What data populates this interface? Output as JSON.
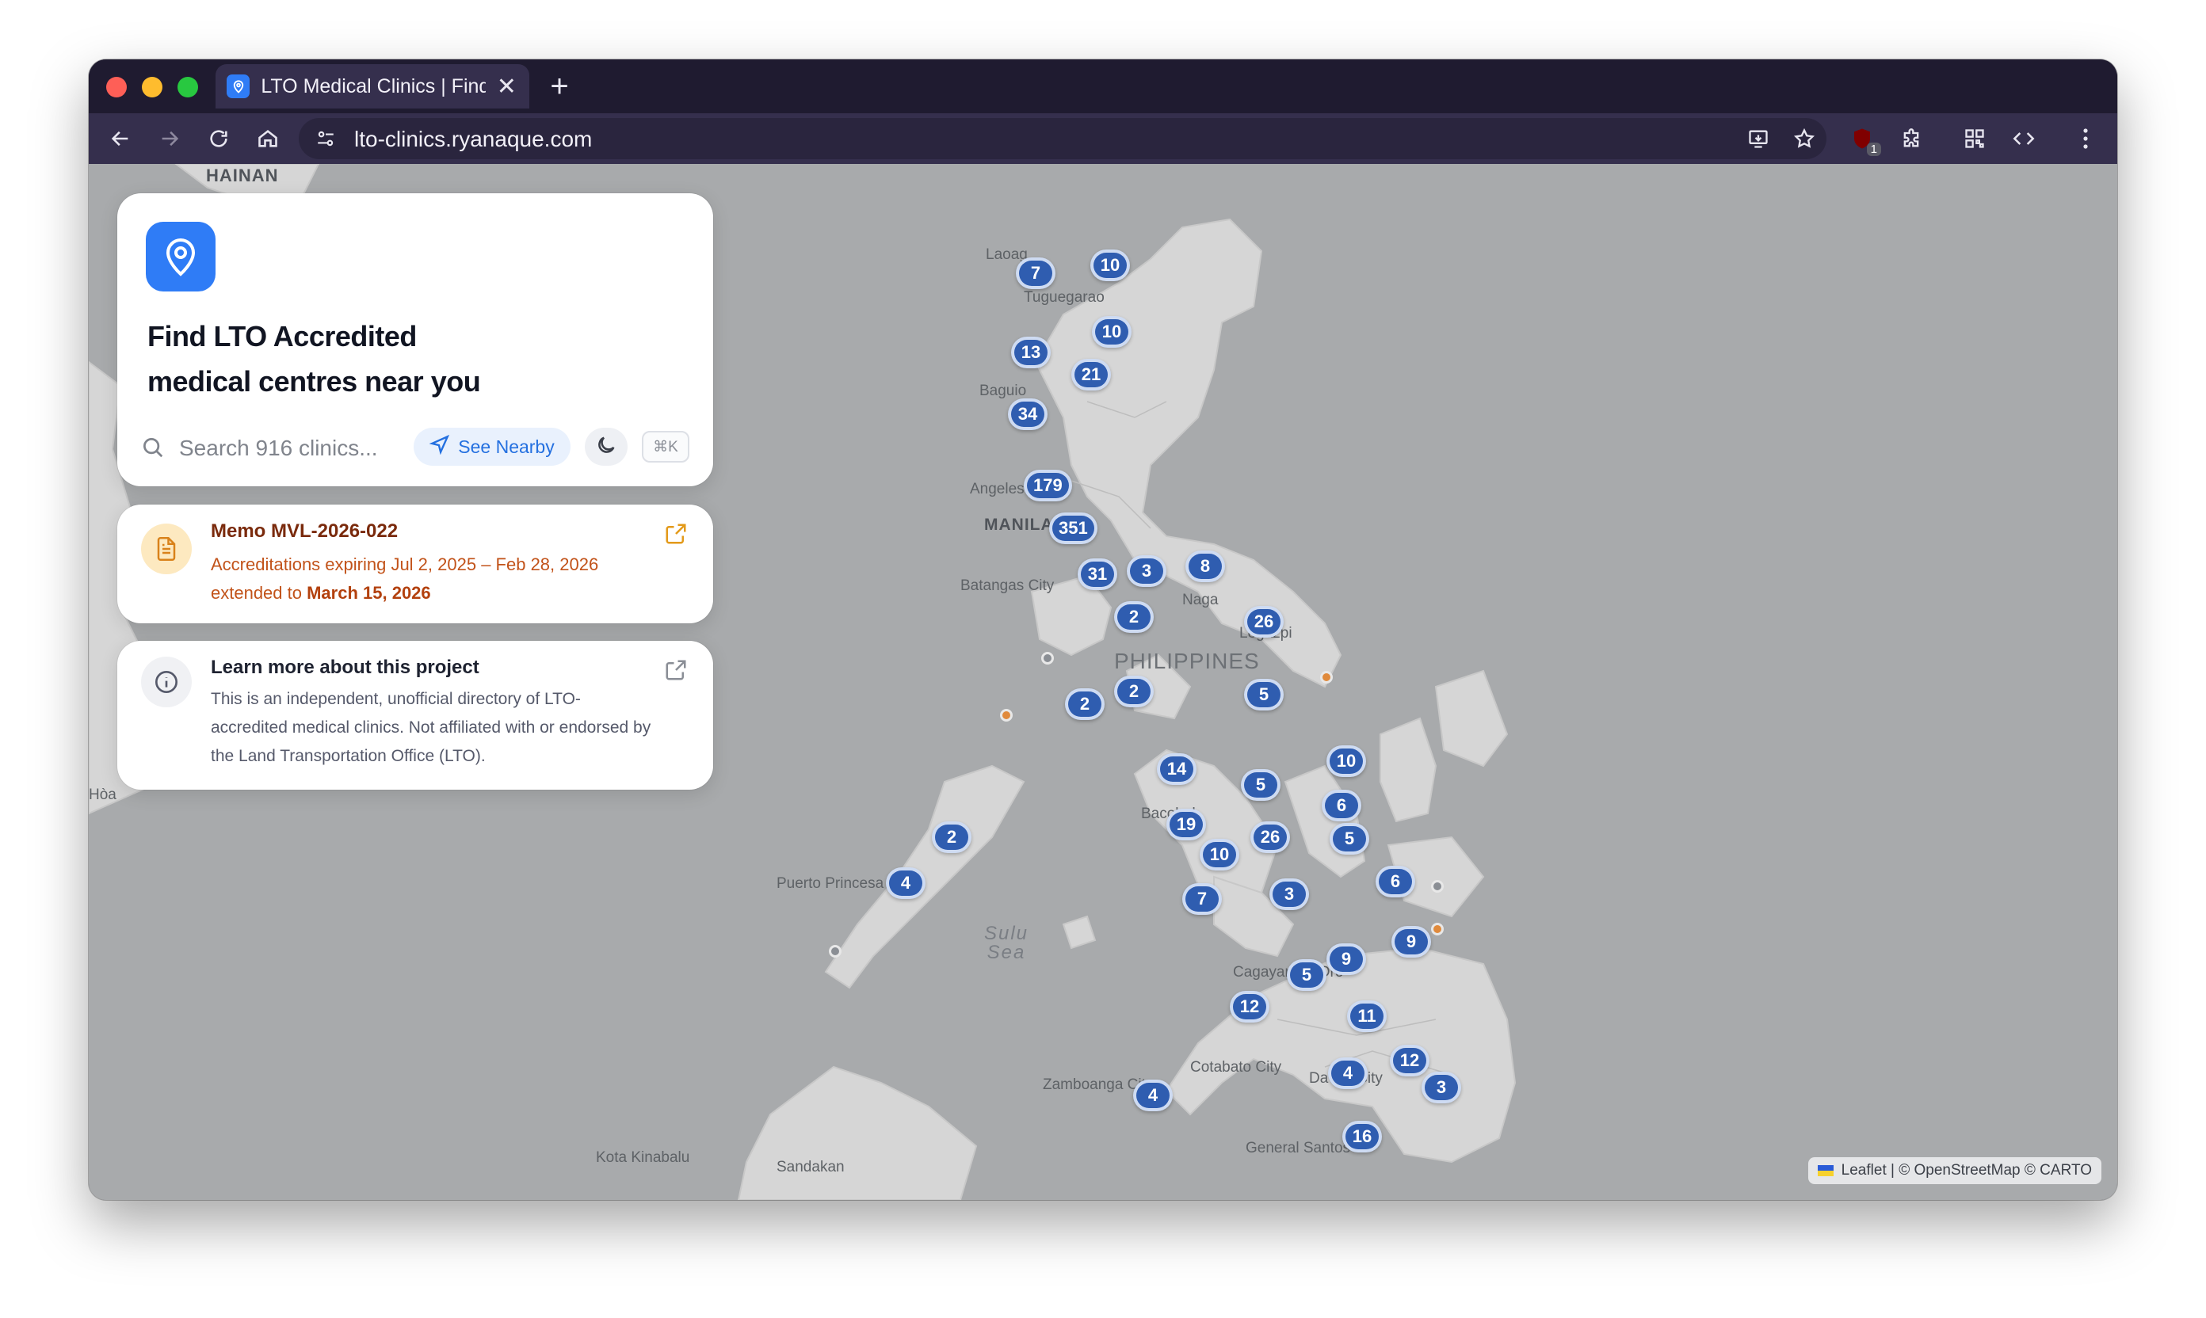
{
  "browser": {
    "tab_title": "LTO Medical Clinics | Find LTO Accredited",
    "url": "lto-clinics.ryanaque.com",
    "extension_badge": "1"
  },
  "hero": {
    "title_line1": "Find LTO Accredited",
    "title_line2": "medical centres near you",
    "search_placeholder": "Search 916 clinics...",
    "nearby_label": "See Nearby",
    "shortcut": "⌘K"
  },
  "memo": {
    "title": "Memo MVL-2026-022",
    "line1": "Accreditations expiring Jul 2, 2025 – Feb 28, 2026",
    "line2_prefix": "extended to",
    "line2_date": "March 15, 2026"
  },
  "info": {
    "title": "Learn more about this project",
    "text": "This is an independent, unofficial directory of LTO-accredited medical clinics. Not affiliated with or endorsed by the Land Transportation Office (LTO)."
  },
  "map": {
    "country": "PHILIPPINES",
    "sea": "Sulu Sea",
    "places": [
      "HAINAN",
      "Laoag",
      "Tuguegarao",
      "Baguio",
      "Angeles",
      "MANILA",
      "Batangas City",
      "Naga",
      "Legazpi",
      "Puerto Princesa",
      "Bacolod",
      "Cagayan de Oro",
      "Cotabato City",
      "Davao City",
      "Zamboanga City",
      "General Santos",
      "Kota Kinabalu",
      "Sandakan",
      "Hòa"
    ],
    "clusters": [
      "7",
      "10",
      "10",
      "13",
      "21",
      "34",
      "179",
      "351",
      "31",
      "3",
      "8",
      "2",
      "26",
      "2",
      "2",
      "5",
      "10",
      "14",
      "5",
      "6",
      "19",
      "10",
      "26",
      "5",
      "6",
      "7",
      "3",
      "9",
      "9",
      "5",
      "12",
      "11",
      "4",
      "12",
      "3",
      "4",
      "16",
      "2",
      "4"
    ],
    "attribution": "Leaflet | © OpenStreetMap © CARTO"
  },
  "colors": {
    "accent": "#2f7cf6",
    "cluster": "#2f5db0",
    "memo_accent": "#c2531a"
  }
}
